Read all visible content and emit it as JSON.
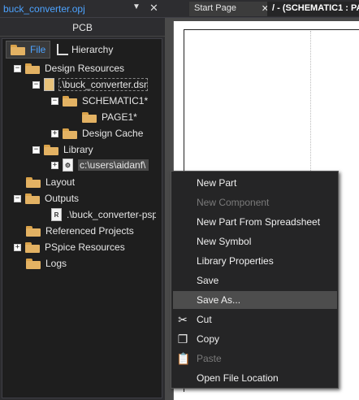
{
  "panel": {
    "title": "buck_converter.opj",
    "pin_glyph": "▼",
    "close_glyph": "✕",
    "subtitle": "PCB",
    "tabs": [
      {
        "label": "File",
        "active": true
      },
      {
        "label": "Hierarchy",
        "active": false
      }
    ]
  },
  "tree": {
    "design_resources": "Design Resources",
    "dsn_file": ".\\buck_converter.dsn",
    "schematic": "SCHEMATIC1*",
    "page": "PAGE1*",
    "design_cache": "Design Cache",
    "library": "Library",
    "library_file": "c:\\users\\aidanf\\",
    "layout": "Layout",
    "outputs": "Outputs",
    "output_file": ".\\buck_converter-psp",
    "referenced_projects": "Referenced Projects",
    "pspice_resources": "PSpice Resources",
    "logs": "Logs"
  },
  "editor": {
    "tabs": [
      {
        "label": "Start Page",
        "close": "✕"
      },
      {
        "label": "/ - (SCHEMATIC1 : PA"
      }
    ]
  },
  "context_menu": {
    "items": [
      {
        "label": "New Part",
        "enabled": true,
        "icon": ""
      },
      {
        "label": "New Component",
        "enabled": false,
        "icon": ""
      },
      {
        "label": "New Part From Spreadsheet",
        "enabled": true,
        "icon": ""
      },
      {
        "label": "New Symbol",
        "enabled": true,
        "icon": ""
      },
      {
        "label": "Library Properties",
        "enabled": true,
        "icon": ""
      },
      {
        "label": "Save",
        "enabled": true,
        "icon": ""
      },
      {
        "label": "Save As...",
        "enabled": true,
        "icon": "",
        "hovered": true
      },
      {
        "label": "Cut",
        "enabled": true,
        "icon": "scissors-icon"
      },
      {
        "label": "Copy",
        "enabled": true,
        "icon": "copy-icon"
      },
      {
        "label": "Paste",
        "enabled": false,
        "icon": "paste-icon"
      },
      {
        "label": "Open File Location",
        "enabled": true,
        "icon": ""
      }
    ]
  },
  "colors": {
    "accent": "#4da3ff",
    "folder": "#e3b263",
    "menu_bg": "#252526",
    "menu_hover": "#4d4d4d"
  }
}
